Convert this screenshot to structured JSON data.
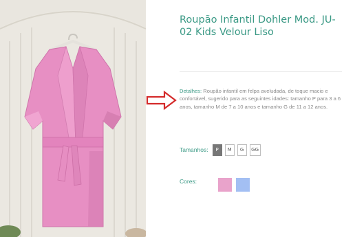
{
  "product": {
    "title": "Roupão Infantil Dohler Mod. JU-02 Kids Velour Liso",
    "details_label": "Detalhes:",
    "details_text": " Roupão infantil em felpa aveludada, de toque macio e confortável, sugerido para as seguintes idades: tamanho P para 3 a 6 anos, tamanho M de 7 a 10 anos e tamanho G de 11 a 12 anos."
  },
  "sizes": {
    "label": "Tamanhos:",
    "options": [
      "P",
      "M",
      "G",
      "GG"
    ],
    "selected": "P"
  },
  "colors": {
    "label": "Cores:",
    "swatches": [
      "#e9a3cb",
      "#a3bff3"
    ]
  },
  "annotation": {
    "arrow_color": "#d42a2a"
  },
  "theme": {
    "accent": "#3c9a86",
    "text_muted": "#8a8a8a",
    "selected_size_bg": "#777777"
  }
}
